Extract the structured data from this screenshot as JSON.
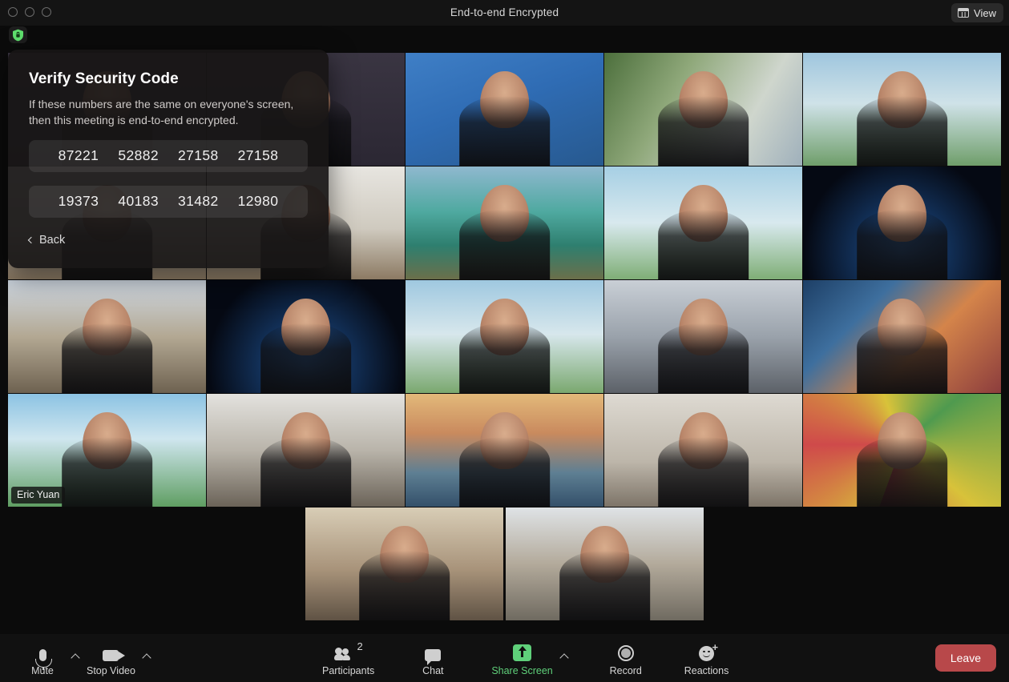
{
  "window": {
    "title": "End-to-end Encrypted",
    "traffic_lights": [
      "close",
      "minimize",
      "maximize"
    ],
    "view_button": {
      "label": "View",
      "icon": "grid-view-icon"
    },
    "encryption_badge_icon": "green-shield-lock-icon"
  },
  "popup": {
    "title": "Verify Security Code",
    "description": "If these numbers are the same on everyone's screen, then this meeting is end-to-end encrypted.",
    "code_row_1": [
      "87221",
      "52882",
      "27158",
      "27158"
    ],
    "code_row_2": [
      "19373",
      "40183",
      "31482",
      "12980"
    ],
    "back_label": "Back",
    "back_icon": "chevron-left-icon"
  },
  "grid": {
    "active_speaker_name": "Eric Yuan",
    "active_border_color": "#dbe776",
    "tiles": [
      {
        "id": 1,
        "bg": "bg-darkwall",
        "row": 1,
        "col": 1
      },
      {
        "id": 2,
        "bg": "bg-darkwall",
        "row": 1,
        "col": 2
      },
      {
        "id": 3,
        "bg": "bg-zoomwall",
        "row": 1,
        "col": 3
      },
      {
        "id": 4,
        "bg": "bg-plant",
        "row": 1,
        "col": 4
      },
      {
        "id": 5,
        "bg": "bg-palm1",
        "row": 1,
        "col": 5
      },
      {
        "id": 6,
        "bg": "bg-room1",
        "row": 2,
        "col": 1
      },
      {
        "id": 7,
        "bg": "bg-room1",
        "row": 2,
        "col": 2
      },
      {
        "id": 8,
        "bg": "bg-lagoon",
        "row": 2,
        "col": 3
      },
      {
        "id": 9,
        "bg": "bg-palm2",
        "row": 2,
        "col": 4
      },
      {
        "id": 10,
        "bg": "bg-space",
        "row": 2,
        "col": 5
      },
      {
        "id": 11,
        "bg": "bg-shelf",
        "row": 3,
        "col": 1
      },
      {
        "id": 12,
        "bg": "bg-space",
        "row": 3,
        "col": 2
      },
      {
        "id": 13,
        "bg": "bg-beach",
        "row": 3,
        "col": 3
      },
      {
        "id": 14,
        "bg": "bg-office",
        "row": 3,
        "col": 4
      },
      {
        "id": 15,
        "bg": "bg-aurora",
        "row": 3,
        "col": 5
      },
      {
        "id": 16,
        "bg": "bg-palmblue",
        "row": 4,
        "col": 1
      },
      {
        "id": 17,
        "bg": "bg-loft",
        "row": 4,
        "col": 2
      },
      {
        "id": 18,
        "bg": "bg-bridge",
        "row": 4,
        "col": 3
      },
      {
        "id": 19,
        "bg": "bg-plainwall",
        "row": 4,
        "col": 4
      },
      {
        "id": 20,
        "bg": "bg-banner",
        "row": 4,
        "col": 5
      },
      {
        "id": 21,
        "bg": "bg-books",
        "row": 5,
        "col": 1
      },
      {
        "id": 22,
        "bg": "bg-openoffice",
        "row": 5,
        "col": 2
      }
    ]
  },
  "toolbar": {
    "mute": {
      "label": "Mute",
      "icon": "microphone-icon"
    },
    "stop_video": {
      "label": "Stop Video",
      "icon": "camera-icon"
    },
    "participants": {
      "label": "Participants",
      "count": "2",
      "icon": "people-icon"
    },
    "chat": {
      "label": "Chat",
      "icon": "chat-bubble-icon"
    },
    "share_screen": {
      "label": "Share Screen",
      "icon": "share-up-arrow-icon",
      "color": "#5fd07a"
    },
    "record": {
      "label": "Record",
      "icon": "record-circle-icon"
    },
    "reactions": {
      "label": "Reactions",
      "icon": "smiley-plus-icon"
    },
    "leave": {
      "label": "Leave",
      "color": "#b8484a"
    }
  }
}
